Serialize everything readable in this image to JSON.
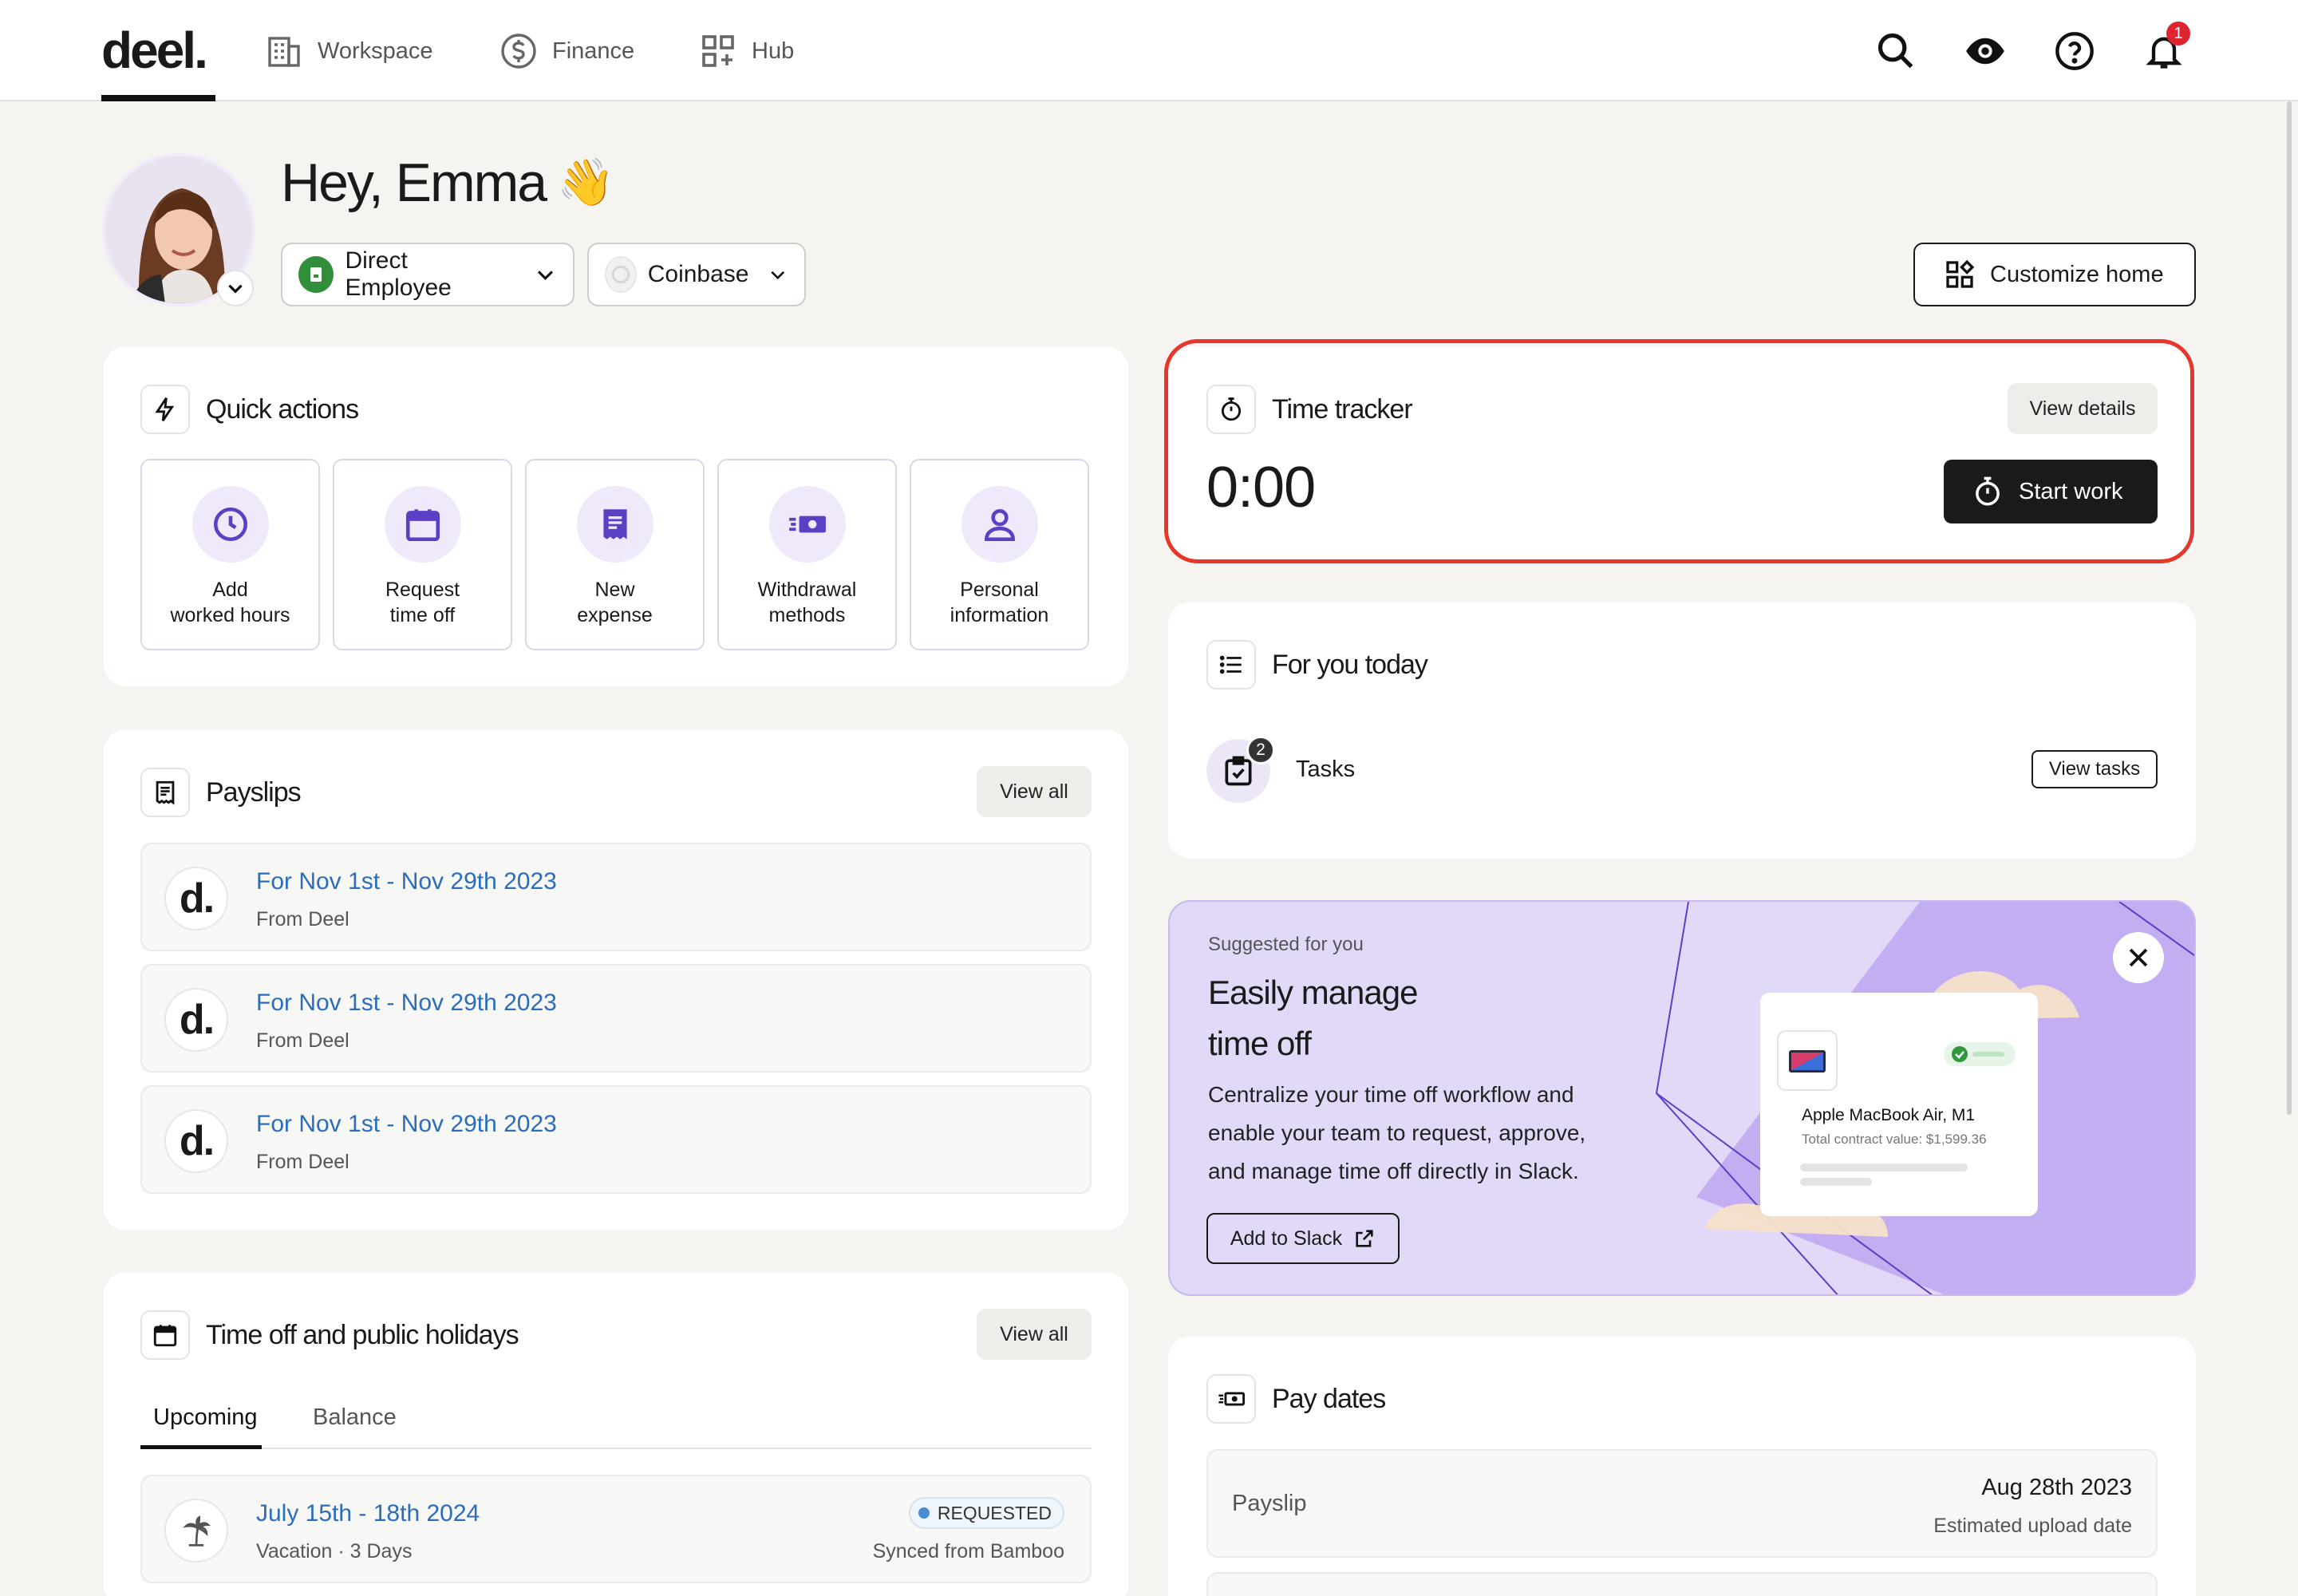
{
  "nav": {
    "logo": "deel.",
    "items": [
      {
        "label": "Workspace",
        "icon": "building-icon"
      },
      {
        "label": "Finance",
        "icon": "dollar-circle-icon"
      },
      {
        "label": "Hub",
        "icon": "grid-plus-icon"
      }
    ],
    "notification_count": "1"
  },
  "header": {
    "greeting": "Hey, Emma",
    "greeting_emoji": "👋",
    "role_pill": "Direct Employee",
    "company_pill": "Coinbase",
    "customize_label": "Customize home"
  },
  "quick_actions": {
    "title": "Quick actions",
    "items": [
      {
        "line1": "Add",
        "line2": "worked hours",
        "icon": "clock-icon"
      },
      {
        "line1": "Request",
        "line2": "time off",
        "icon": "calendar-icon"
      },
      {
        "line1": "New",
        "line2": "expense",
        "icon": "receipt-icon"
      },
      {
        "line1": "Withdrawal",
        "line2": "methods",
        "icon": "cash-icon"
      },
      {
        "line1": "Personal",
        "line2": "information",
        "icon": "person-icon"
      }
    ]
  },
  "payslips": {
    "title": "Payslips",
    "view_all": "View all",
    "items": [
      {
        "period": "For Nov 1st - Nov 29th 2023",
        "source": "From Deel",
        "logo": "d."
      },
      {
        "period": "For Nov 1st - Nov 29th 2023",
        "source": "From Deel",
        "logo": "d."
      },
      {
        "period": "For Nov 1st - Nov 29th 2023",
        "source": "From Deel",
        "logo": "d."
      }
    ]
  },
  "time_off": {
    "title": "Time off and public holidays",
    "view_all": "View all",
    "tabs": [
      "Upcoming",
      "Balance"
    ],
    "item": {
      "dates": "July 15th - 18th 2024",
      "detail": "Vacation · 3 Days",
      "status": "REQUESTED",
      "synced": "Synced from Bamboo"
    }
  },
  "time_tracker": {
    "title": "Time tracker",
    "view_details": "View details",
    "timer": "0:00",
    "start_label": "Start work"
  },
  "for_you": {
    "title": "For you today",
    "tasks_label": "Tasks",
    "tasks_count": "2",
    "view_tasks": "View tasks"
  },
  "promo": {
    "eyebrow": "Suggested for you",
    "title_line1": "Easily manage",
    "title_line2": "time off",
    "body_line1": "Centralize your time off workflow and",
    "body_line2": "enable your team to request, approve,",
    "body_line3": "and manage time off directly in Slack.",
    "button": "Add to Slack",
    "product_name": "Apple MacBook Air, M1",
    "product_value": "Total contract value: $1,599.36"
  },
  "pay_dates": {
    "title": "Pay dates",
    "item": {
      "label": "Payslip",
      "date": "Aug 28th 2023",
      "note": "Estimated upload date"
    }
  },
  "colors": {
    "accent_purple": "#5b3fc4",
    "link_blue": "#2a6dbb",
    "highlight_red": "#e8372a",
    "badge_red": "#e0242f"
  }
}
